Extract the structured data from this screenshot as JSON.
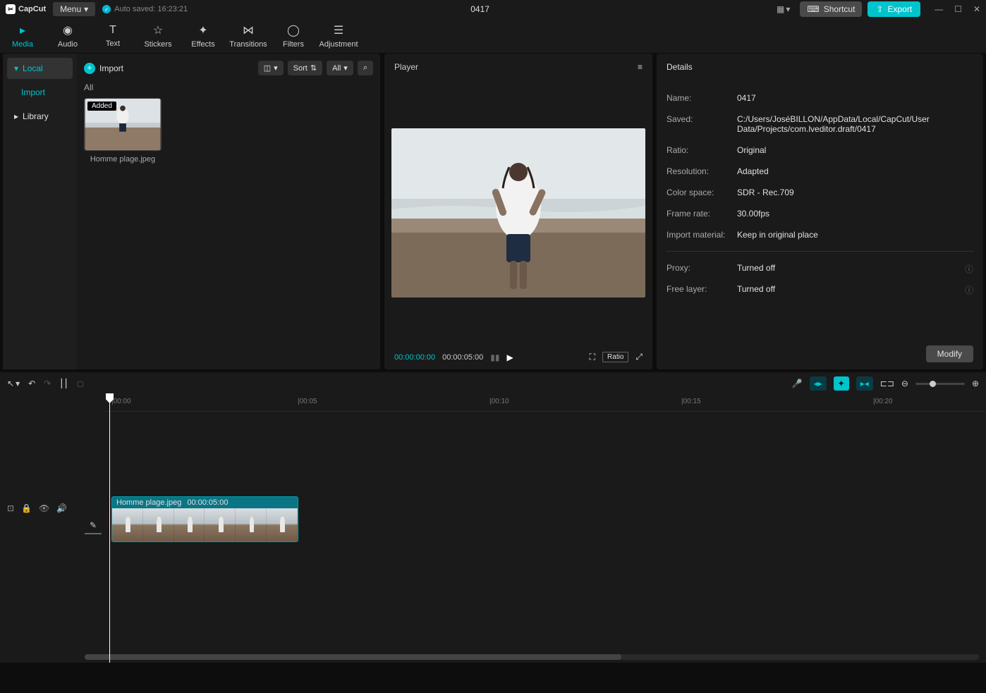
{
  "app": {
    "name": "CapCut",
    "menu_label": "Menu",
    "autosave_label": "Auto saved: 16:23:21",
    "title": "0417"
  },
  "title_actions": {
    "shortcut": "Shortcut",
    "export": "Export"
  },
  "top_tabs": [
    {
      "label": "Media"
    },
    {
      "label": "Audio"
    },
    {
      "label": "Text"
    },
    {
      "label": "Stickers"
    },
    {
      "label": "Effects"
    },
    {
      "label": "Transitions"
    },
    {
      "label": "Filters"
    },
    {
      "label": "Adjustment"
    }
  ],
  "sidebar": {
    "local": "Local",
    "import": "Import",
    "library": "Library"
  },
  "media": {
    "import_btn": "Import",
    "sort": "Sort",
    "all": "All",
    "section": "All",
    "thumb_badge": "Added",
    "thumb_name": "Homme plage.jpeg"
  },
  "player": {
    "title": "Player",
    "current": "00:00:00:00",
    "total": "00:00:05:00",
    "ratio": "Ratio"
  },
  "details": {
    "title": "Details",
    "rows": {
      "name_label": "Name:",
      "name_value": "0417",
      "saved_label": "Saved:",
      "saved_value": "C:/Users/JoséBILLON/AppData/Local/CapCut/User Data/Projects/com.lveditor.draft/0417",
      "ratio_label": "Ratio:",
      "ratio_value": "Original",
      "resolution_label": "Resolution:",
      "resolution_value": "Adapted",
      "colorspace_label": "Color space:",
      "colorspace_value": "SDR - Rec.709",
      "framerate_label": "Frame rate:",
      "framerate_value": "30.00fps",
      "importmat_label": "Import material:",
      "importmat_value": "Keep in original place",
      "proxy_label": "Proxy:",
      "proxy_value": "Turned off",
      "freelayer_label": "Free layer:",
      "freelayer_value": "Turned off"
    },
    "modify": "Modify"
  },
  "timeline": {
    "marks": [
      "|00:00",
      "|00:05",
      "|00:10",
      "|00:15",
      "|00:20"
    ],
    "clip_name": "Homme plage.jpeg",
    "clip_duration": "00:00:05:00"
  }
}
